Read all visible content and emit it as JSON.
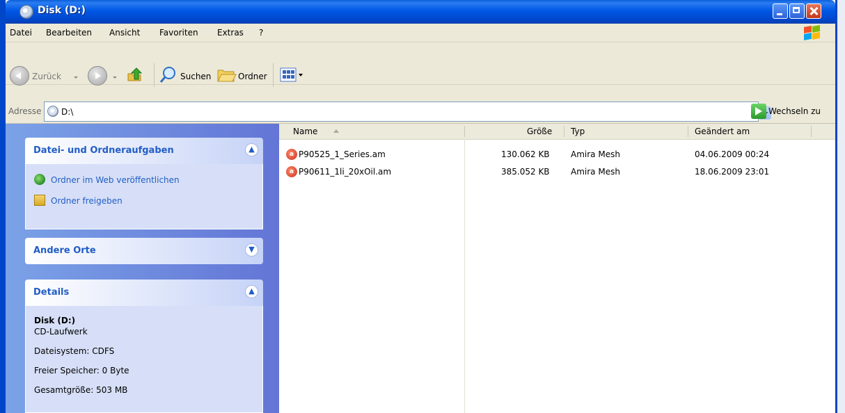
{
  "window": {
    "title": "Disk (D:)"
  },
  "menu": [
    "Datei",
    "Bearbeiten",
    "Ansicht",
    "Favoriten",
    "Extras",
    "?"
  ],
  "toolbar": {
    "back_label": "Zurück",
    "search_label": "Suchen",
    "folders_label": "Ordner"
  },
  "address": {
    "label": "Adresse",
    "value": "D:\\",
    "go_label": "Wechseln zu"
  },
  "taskpane": {
    "tasks": {
      "title": "Datei- und Ordneraufgaben",
      "collapse_glyph": "»",
      "items": [
        "Ordner im Web veröffentlichen",
        "Ordner freigeben"
      ]
    },
    "other_places": {
      "title": "Andere Orte"
    },
    "details": {
      "title": "Details",
      "name": "Disk (D:)",
      "type": "CD-Laufwerk",
      "filesystem": "Dateisystem: CDFS",
      "free_space": "Freier Speicher: 0 Byte",
      "total_size": "Gesamtgröße: 503 MB"
    }
  },
  "filelist": {
    "columns": {
      "name": "Name",
      "size": "Größe",
      "type": "Typ",
      "modified": "Geändert am"
    },
    "rows": [
      {
        "name": "P90525_1_Series.am",
        "size": "130.062 KB",
        "type": "Amira Mesh",
        "modified": "04.06.2009 00:24"
      },
      {
        "name": "P90611_1li_20xOil.am",
        "size": "385.052 KB",
        "type": "Amira Mesh",
        "modified": "18.06.2009 23:01"
      }
    ]
  },
  "colors": {
    "titlebar": "#0058e6",
    "taskpane_link": "#215dc6",
    "taskpane_bg": "#6375d6"
  }
}
